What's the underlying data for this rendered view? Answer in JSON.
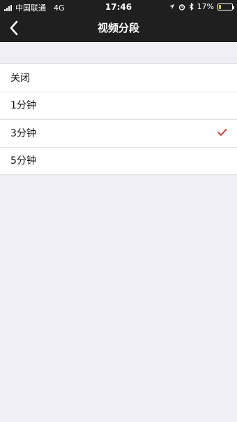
{
  "status_bar": {
    "carrier": "中国联通",
    "network": "4G",
    "time": "17:46",
    "battery": "17%"
  },
  "nav": {
    "title": "视频分段",
    "back_icon": "chevron-left-icon"
  },
  "options": [
    {
      "label": "关闭",
      "selected": false
    },
    {
      "label": "1分钟",
      "selected": false
    },
    {
      "label": "3分钟",
      "selected": true
    },
    {
      "label": "5分钟",
      "selected": false
    }
  ],
  "colors": {
    "bar": "#1f1f1f",
    "background": "#efeff4",
    "check": "#d0312d"
  }
}
